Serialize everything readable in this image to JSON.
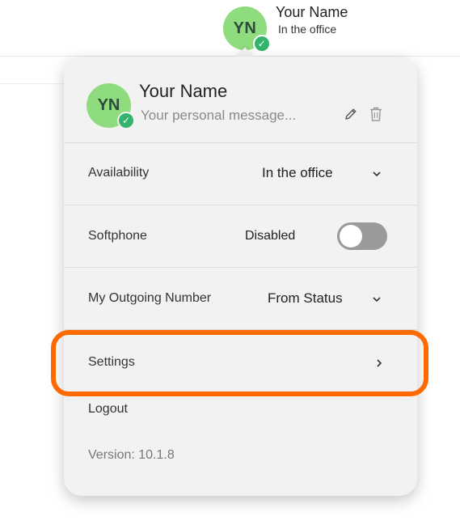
{
  "header": {
    "avatar_initials": "YN",
    "name": "Your Name",
    "status": "In the office"
  },
  "profile": {
    "avatar_initials": "YN",
    "name": "Your Name",
    "message_placeholder": "Your personal message..."
  },
  "rows": {
    "availability": {
      "label": "Availability",
      "value": "In the office"
    },
    "softphone": {
      "label": "Softphone",
      "value": "Disabled",
      "enabled": false
    },
    "outgoing": {
      "label": "My Outgoing Number",
      "value": "From Status"
    },
    "settings": {
      "label": "Settings"
    },
    "logout": {
      "label": "Logout"
    }
  },
  "version": "Version: 10.1.8",
  "colors": {
    "avatar_bg": "#8fdc7f",
    "status_green": "#33b36b",
    "highlight": "#ff6a00",
    "panel_bg": "#f2f2f2"
  },
  "icons": [
    "check-icon",
    "pencil-icon",
    "trash-icon",
    "chevron-down-icon",
    "chevron-right-icon"
  ]
}
